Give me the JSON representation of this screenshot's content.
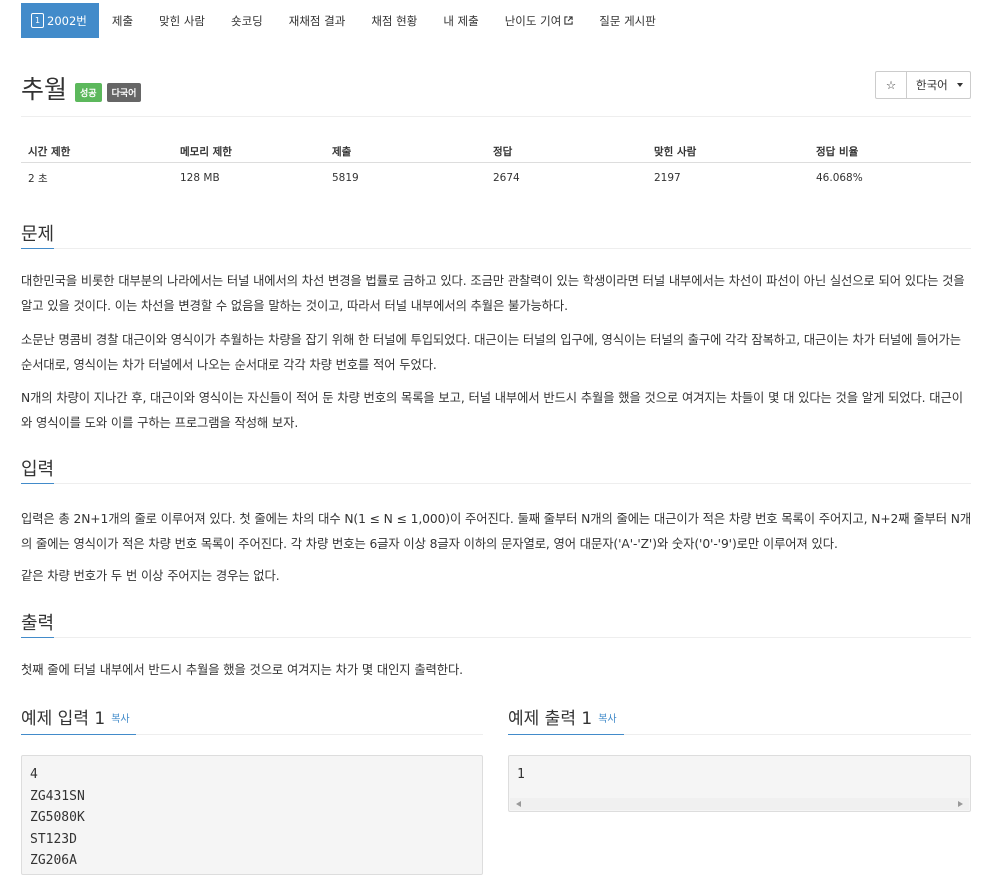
{
  "tabs": [
    {
      "label": "2002번",
      "active": true
    },
    {
      "label": "제출"
    },
    {
      "label": "맞힌 사람"
    },
    {
      "label": "숏코딩"
    },
    {
      "label": "재채점 결과"
    },
    {
      "label": "채점 현황"
    },
    {
      "label": "내 제출"
    },
    {
      "label": "난이도 기여"
    },
    {
      "label": "질문 게시판"
    }
  ],
  "tier_badge": "1",
  "title": "추월",
  "labels": {
    "success": "성공",
    "language": "다국어"
  },
  "star_glyph": "☆",
  "language_select": "한국어",
  "info_table": {
    "headers": [
      "시간 제한",
      "메모리 제한",
      "제출",
      "정답",
      "맞힌 사람",
      "정답 비율"
    ],
    "row": [
      "2 초",
      "128 MB",
      "5819",
      "2674",
      "2197",
      "46.068%"
    ]
  },
  "sections": {
    "problem": {
      "title": "문제",
      "paragraphs": [
        "대한민국을 비롯한 대부분의 나라에서는 터널 내에서의 차선 변경을 법률로 금하고 있다. 조금만 관찰력이 있는 학생이라면 터널 내부에서는 차선이 파선이 아닌 실선으로 되어 있다는 것을 알고 있을 것이다. 이는 차선을 변경할 수 없음을 말하는 것이고, 따라서 터널 내부에서의 추월은 불가능하다.",
        "소문난 명콤비 경찰 대근이와 영식이가 추월하는 차량을 잡기 위해 한 터널에 투입되었다. 대근이는 터널의 입구에, 영식이는 터널의 출구에 각각 잠복하고, 대근이는 차가 터널에 들어가는 순서대로, 영식이는 차가 터널에서 나오는 순서대로 각각 차량 번호를 적어 두었다.",
        "N개의 차량이 지나간 후, 대근이와 영식이는 자신들이 적어 둔 차량 번호의 목록을 보고, 터널 내부에서 반드시 추월을 했을 것으로 여겨지는 차들이 몇 대 있다는 것을 알게 되었다. 대근이와 영식이를 도와 이를 구하는 프로그램을 작성해 보자."
      ]
    },
    "input": {
      "title": "입력",
      "paragraphs": [
        "입력은 총 2N+1개의 줄로 이루어져 있다. 첫 줄에는 차의 대수 N(1 ≤ N ≤ 1,000)이 주어진다. 둘째 줄부터 N개의 줄에는 대근이가 적은 차량 번호 목록이 주어지고, N+2째 줄부터 N개의 줄에는 영식이가 적은 차량 번호 목록이 주어진다. 각 차량 번호는 6글자 이상 8글자 이하의 문자열로, 영어 대문자('A'-'Z')와 숫자('0'-'9')로만 이루어져 있다.",
        "같은 차량 번호가 두 번 이상 주어지는 경우는 없다."
      ]
    },
    "output": {
      "title": "출력",
      "paragraphs": [
        "첫째 줄에 터널 내부에서 반드시 추월을 했을 것으로 여겨지는 차가 몇 대인지 출력한다."
      ]
    }
  },
  "samples": {
    "input": {
      "title": "예제 입력 1",
      "copy": "복사",
      "lines": [
        "4",
        "ZG431SN",
        "ZG5080K",
        "ST123D",
        "ZG206A"
      ]
    },
    "output": {
      "title": "예제 출력 1",
      "copy": "복사",
      "lines": [
        "1"
      ]
    }
  }
}
